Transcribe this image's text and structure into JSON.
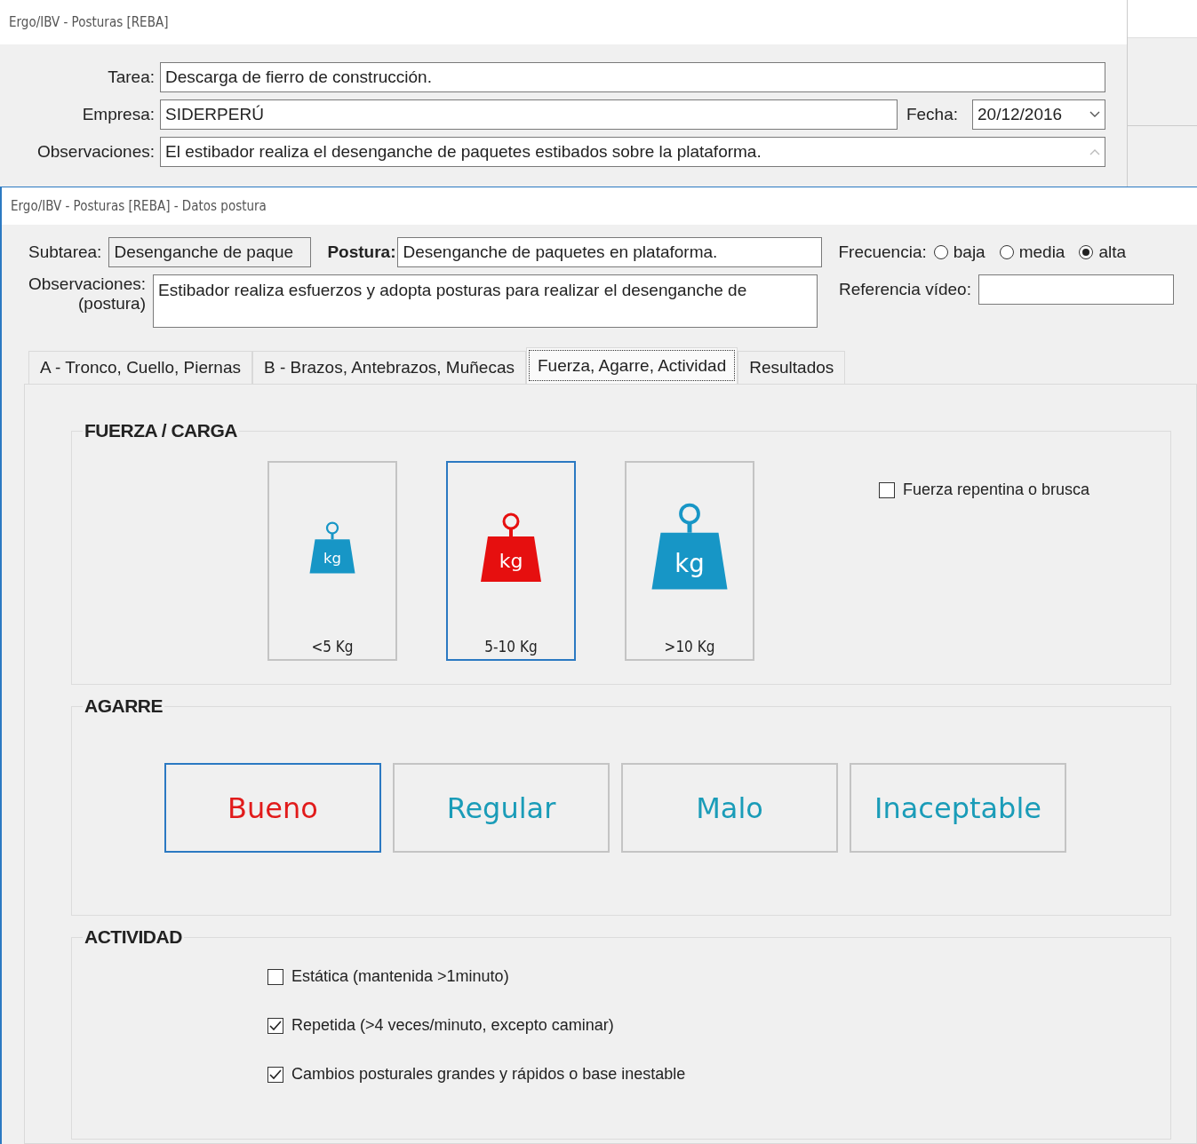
{
  "back_window": {
    "title": "Ergo/IBV - Posturas [REBA]",
    "fields": [
      {
        "label": "Tarea:",
        "value": "Descarga de fierro de construcción."
      },
      {
        "label": "Empresa:",
        "value": "SIDERPERÚ"
      },
      {
        "label": "Observaciones:",
        "value": "El estibador realiza el desenganche de paquetes estibados sobre la plataforma."
      }
    ],
    "date": {
      "label": "Fecha:",
      "value": "20/12/2016"
    }
  },
  "window": {
    "title": "Ergo/IBV - Posturas [REBA] - Datos postura"
  },
  "subtarea": {
    "label": "Subtarea:",
    "value": "Desenganche de paque"
  },
  "postura": {
    "label": "Postura:",
    "value": "Desenganche de paquetes en plataforma."
  },
  "frecuencia": {
    "label": "Frecuencia:",
    "options": [
      {
        "label": "baja",
        "selected": false
      },
      {
        "label": "media",
        "selected": false
      },
      {
        "label": "alta",
        "selected": true
      }
    ]
  },
  "observaciones": {
    "label": "Observaciones:",
    "sublabel": "(postura)",
    "value": "Estibador realiza esfuerzos y adopta posturas para realizar el desenganche de"
  },
  "referencia": {
    "label": "Referencia vídeo:"
  },
  "tabs": [
    {
      "label": "A - Tronco, Cuello, Piernas",
      "selected": false
    },
    {
      "label": "B - Brazos, Antebrazos, Muñecas",
      "selected": false
    },
    {
      "label": "Fuerza, Agarre, Actividad",
      "selected": true
    },
    {
      "label": "Resultados",
      "selected": false
    }
  ],
  "fuerza": {
    "title": "FUERZA / CARGA",
    "options": [
      {
        "kind": "small",
        "icon_text": "kg",
        "label": "<5 Kg",
        "selected": false
      },
      {
        "kind": "medium",
        "icon_text": "kg",
        "label": "5-10 Kg",
        "selected": true
      },
      {
        "kind": "large",
        "icon_text": "kg",
        "label": ">10 Kg",
        "selected": false
      }
    ],
    "sudden": {
      "label": "Fuerza repentina o brusca",
      "checked": false
    }
  },
  "agarre": {
    "title": "AGARRE",
    "options": [
      {
        "label": "Bueno",
        "selected": true
      },
      {
        "label": "Regular",
        "selected": false
      },
      {
        "label": "Malo",
        "selected": false
      },
      {
        "label": "Inaceptable",
        "selected": false
      }
    ]
  },
  "actividad": {
    "title": "ACTIVIDAD",
    "items": [
      {
        "label": "Estática (mantenida >1minuto)",
        "checked": false
      },
      {
        "label": "Repetida (>4 veces/minuto, excepto caminar)",
        "checked": true
      },
      {
        "label": "Cambios posturales grandes y rápidos o base inestable",
        "checked": true
      }
    ]
  }
}
